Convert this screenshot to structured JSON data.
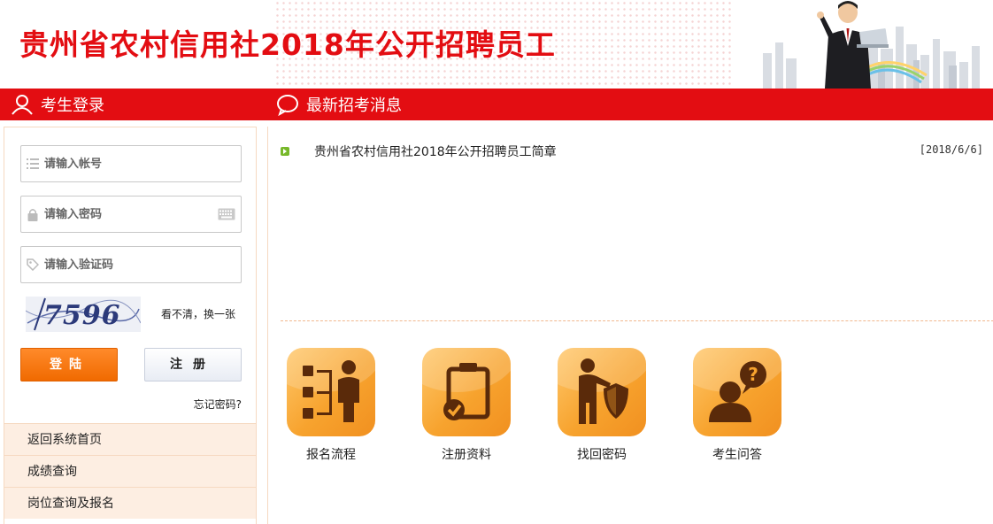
{
  "header": {
    "title": "贵州省农村信用社2018年公开招聘员工"
  },
  "nav": {
    "login_title": "考生登录",
    "news_title": "最新招考消息"
  },
  "login": {
    "account_placeholder": "请输入帐号",
    "password_placeholder": "请输入密码",
    "captcha_placeholder": "请输入验证码",
    "captcha_code": "7596",
    "refresh_captcha": "看不清，换一张",
    "login_button": "登陆",
    "register_button": "注册",
    "forgot_password": "忘记密码?"
  },
  "menu": {
    "items": [
      {
        "label": "返回系统首页"
      },
      {
        "label": "成绩查询"
      },
      {
        "label": "岗位查询及报名"
      }
    ]
  },
  "news": {
    "items": [
      {
        "title": "贵州省农村信用社2018年公开招聘员工简章",
        "date": "[2018/6/6]"
      }
    ]
  },
  "tiles": [
    {
      "label": "报名流程",
      "icon": "process-flow-icon"
    },
    {
      "label": "注册资料",
      "icon": "clipboard-check-icon"
    },
    {
      "label": "找回密码",
      "icon": "person-shield-icon"
    },
    {
      "label": "考生问答",
      "icon": "question-person-icon"
    }
  ],
  "colors": {
    "brand_red": "#e30d12",
    "login_orange": "#f06a00",
    "tile_orange": "#f7a32e",
    "menu_bg": "#fdeee2"
  }
}
